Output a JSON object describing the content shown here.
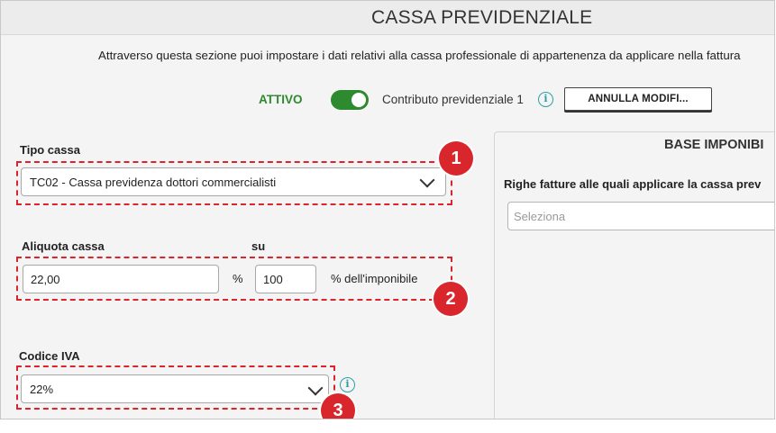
{
  "header": {
    "title": "CASSA PREVIDENZIALE"
  },
  "description": "Attraverso questa sezione puoi impostare i dati relativi alla cassa professionale di appartenenza da applicare nella fattura",
  "status": {
    "active_label": "ATTIVO",
    "toggle_on": true,
    "contribution_label": "Contributo previdenziale 1",
    "cancel_button_label": "ANNULLA MODIFI..."
  },
  "tipo_cassa": {
    "label": "Tipo cassa",
    "selected": "TC02 - Cassa previdenza dottori commercialisti"
  },
  "aliquota": {
    "label": "Aliquota cassa",
    "value": "22,00",
    "percent_symbol": "%",
    "su_label": "su",
    "base_value": "100",
    "suffix": "% dell'imponibile"
  },
  "codice_iva": {
    "label": "Codice IVA",
    "selected": "22%"
  },
  "base_imponibile": {
    "title": "BASE IMPONIBI",
    "rows_label": "Righe fatture alle quali applicare la cassa prev",
    "select_placeholder": "Seleziona"
  },
  "callouts": [
    "1",
    "2",
    "3"
  ],
  "colors": {
    "accent_green": "#2e8a2e",
    "callout_red": "#d9262c",
    "info_teal": "#2aa0a8"
  }
}
